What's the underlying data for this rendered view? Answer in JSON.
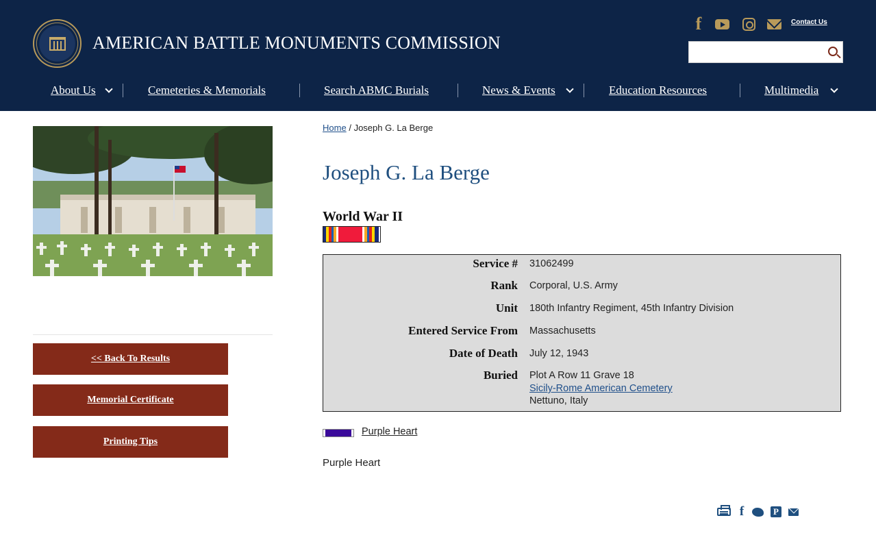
{
  "header": {
    "site_title": "AMERICAN BATTLE MONUMENTS COMMISSION",
    "contact_label": "Contact Us",
    "search": {
      "value": "",
      "placeholder": ""
    },
    "social_icons": [
      "facebook-icon",
      "youtube-icon",
      "instagram-icon",
      "email-icon"
    ],
    "social_fb_glyph": "f",
    "nav": [
      {
        "label": "About Us",
        "has_dropdown": true
      },
      {
        "label": "Cemeteries & Memorials",
        "has_dropdown": false
      },
      {
        "label": "Search ABMC Burials",
        "has_dropdown": false
      },
      {
        "label": "News & Events",
        "has_dropdown": true
      },
      {
        "label": "Education Resources",
        "has_dropdown": false
      },
      {
        "label": "Multimedia",
        "has_dropdown": true
      }
    ]
  },
  "sidebar": {
    "buttons": [
      {
        "label": "<< Back To Results"
      },
      {
        "label": "Memorial Certificate"
      },
      {
        "label": "Printing Tips"
      }
    ]
  },
  "breadcrumb": {
    "home": "Home",
    "separator": "/",
    "current": "Joseph G. La Berge"
  },
  "profile": {
    "name": "Joseph G. La Berge",
    "war": "World War II",
    "fields": [
      {
        "label": "Service #",
        "value": "31062499"
      },
      {
        "label": "Rank",
        "value": "Corporal, U.S. Army"
      },
      {
        "label": "Unit",
        "value": "180th Infantry Regiment, 45th Infantry Division"
      },
      {
        "label": "Entered Service From",
        "value": "Massachusetts"
      },
      {
        "label": "Date of Death",
        "value": "July 12, 1943"
      }
    ],
    "buried": {
      "label": "Buried",
      "plot": "Plot A Row 11 Grave 18",
      "cemetery": "Sicily-Rome American Cemetery",
      "location": "Nettuno, Italy"
    },
    "award": {
      "link": "Purple Heart",
      "text": "Purple Heart"
    }
  },
  "share": {
    "icons": [
      "print-icon",
      "facebook-share-icon",
      "twitter-share-icon",
      "pinterest-share-icon",
      "email-share-icon"
    ],
    "fb_glyph": "f",
    "pin_glyph": "P"
  },
  "colors": {
    "header_bg": "#0d2447",
    "accent_gold": "#b89a5a",
    "button_bg": "#842a19",
    "title_blue": "#1f4f7f",
    "table_bg": "#dcdcdc",
    "purple_heart": "#3a0a9a"
  }
}
